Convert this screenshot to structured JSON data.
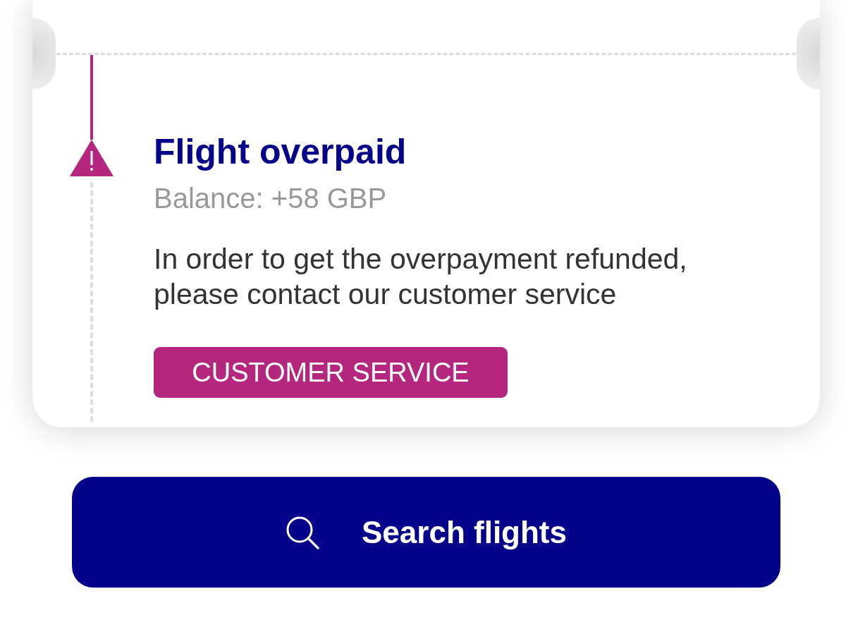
{
  "ticket": {
    "notice": {
      "title": "Flight overpaid",
      "balance": "Balance: +58 GBP",
      "message": "In order to get the overpayment refunded, please contact our customer service",
      "action": "CUSTOMER SERVICE"
    }
  },
  "search_button": {
    "label": "Search flights"
  }
}
